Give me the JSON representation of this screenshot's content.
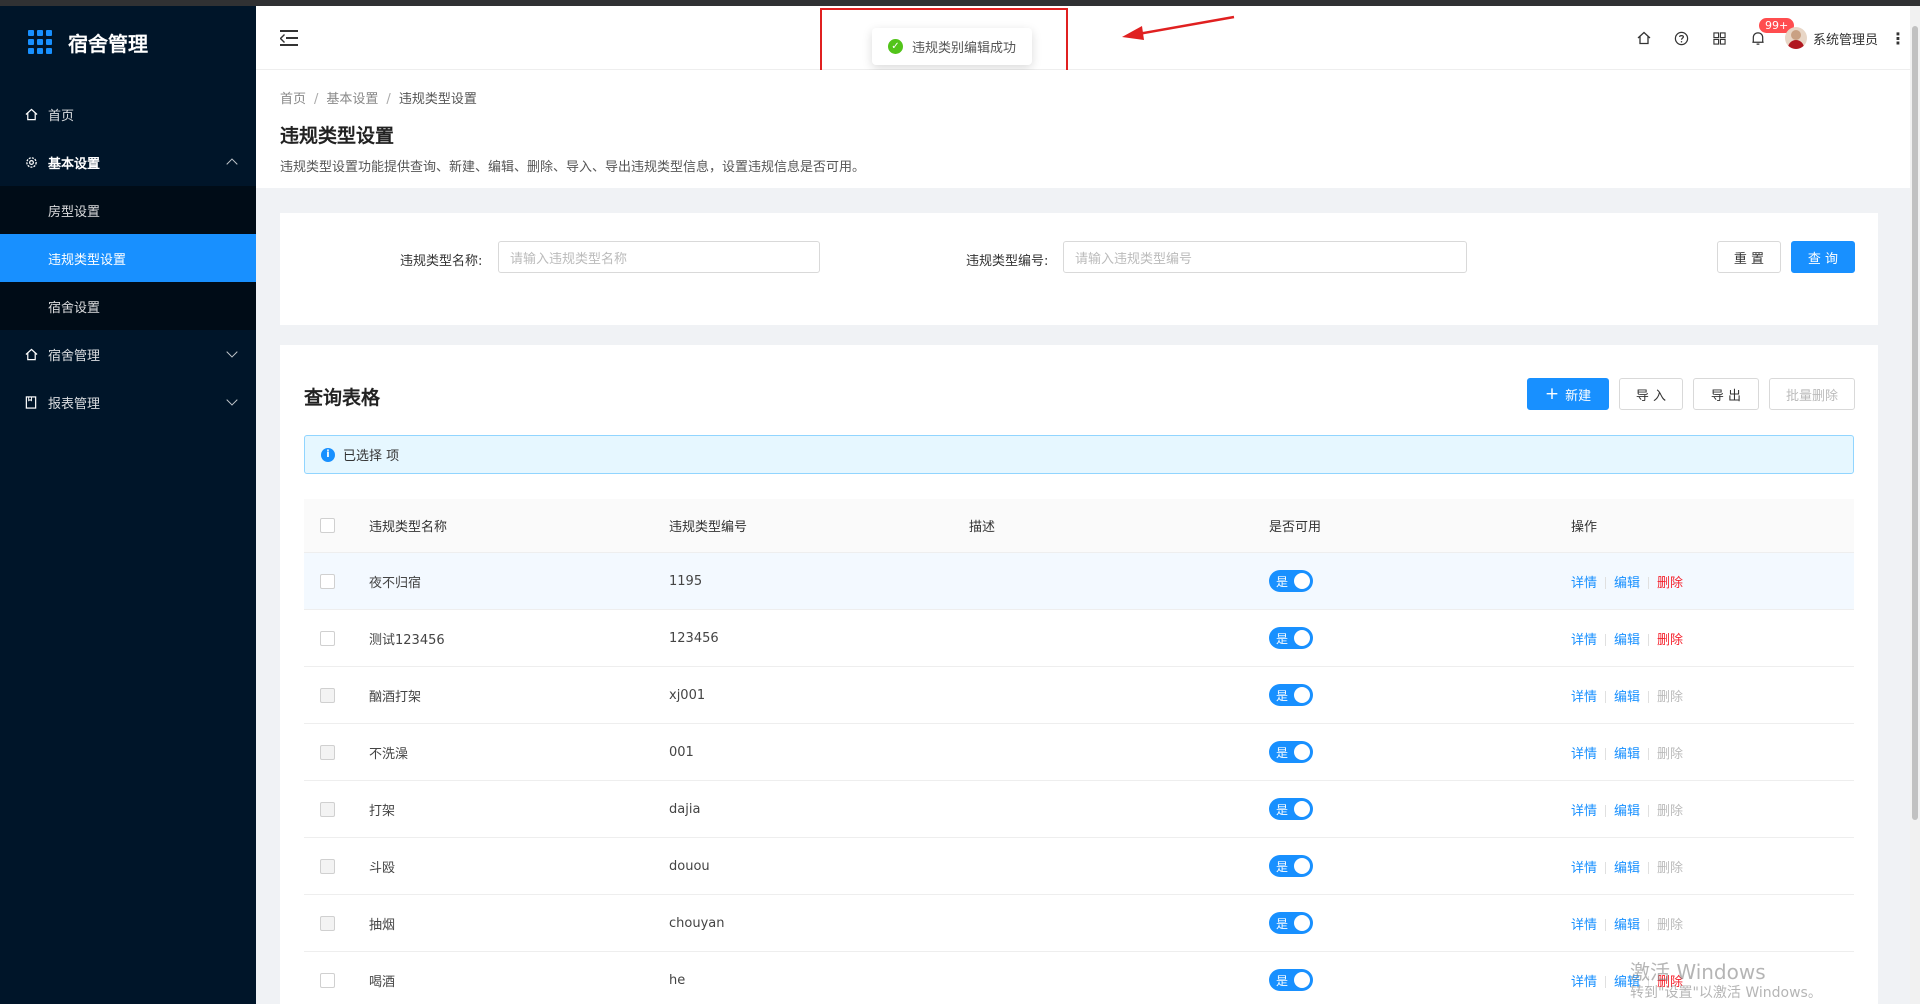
{
  "app": {
    "title": "宿舍管理"
  },
  "sidebar": {
    "items": [
      {
        "label": "首页",
        "icon": "home-icon"
      },
      {
        "label": "基本设置",
        "icon": "gear-icon",
        "open": true,
        "children": [
          {
            "label": "房型设置"
          },
          {
            "label": "违规类型设置",
            "active": true
          },
          {
            "label": "宿舍设置"
          }
        ]
      },
      {
        "label": "宿舍管理",
        "icon": "home-icon"
      },
      {
        "label": "报表管理",
        "icon": "report-icon"
      }
    ]
  },
  "header": {
    "badge": "99+",
    "user_name": "系统管理员",
    "more": "⋮"
  },
  "toast": {
    "message": "违规类别编辑成功"
  },
  "page": {
    "breadcrumb": [
      "首页",
      "基本设置",
      "违规类型设置"
    ],
    "title": "违规类型设置",
    "description": "违规类型设置功能提供查询、新建、编辑、删除、导入、导出违规类型信息，设置违规信息是否可用。"
  },
  "filter": {
    "name_label": "违规类型名称:",
    "name_placeholder": "请输入违规类型名称",
    "code_label": "违规类型编号:",
    "code_placeholder": "请输入违规类型编号",
    "reset_label": "重 置",
    "search_label": "查 询"
  },
  "table_card": {
    "title": "查询表格",
    "new_label": "新建",
    "import_label": "导 入",
    "export_label": "导 出",
    "batch_delete_label": "批量删除",
    "alert": "已选择 项",
    "columns": [
      "违规类型名称",
      "违规类型编号",
      "描述",
      "是否可用",
      "操作"
    ],
    "rows": [
      {
        "name": "夜不归宿",
        "code": "1195",
        "desc": "",
        "enabled": "是",
        "deletable": true
      },
      {
        "name": "测试123456",
        "code": "123456",
        "desc": "",
        "enabled": "是",
        "deletable": true
      },
      {
        "name": "酗酒打架",
        "code": "xj001",
        "desc": "",
        "enabled": "是",
        "deletable": false
      },
      {
        "name": "不洗澡",
        "code": "001",
        "desc": "",
        "enabled": "是",
        "deletable": false
      },
      {
        "name": "打架",
        "code": "dajia",
        "desc": "",
        "enabled": "是",
        "deletable": false
      },
      {
        "name": "斗殴",
        "code": "douou",
        "desc": "",
        "enabled": "是",
        "deletable": false
      },
      {
        "name": "抽烟",
        "code": "chouyan",
        "desc": "",
        "enabled": "是",
        "deletable": false
      },
      {
        "name": "喝酒",
        "code": "he",
        "desc": "",
        "enabled": "是",
        "deletable": true
      }
    ],
    "actions": {
      "detail": "详情",
      "edit": "编辑",
      "delete": "删除"
    }
  },
  "watermark": {
    "line1": "激活 Windows",
    "line2": "转到\"设置\"以激活 Windows。"
  }
}
